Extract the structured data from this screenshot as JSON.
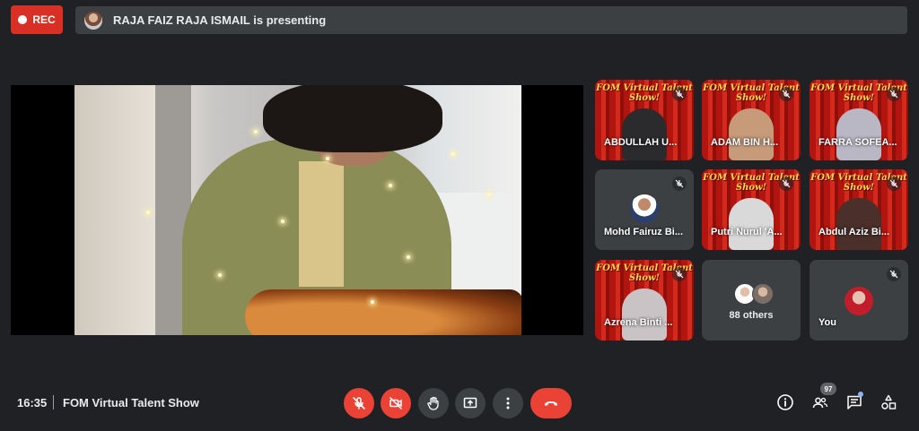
{
  "top_bar": {
    "record_label": "REC",
    "presenting_text": "RAJA FAIZ RAJA ISMAIL is presenting"
  },
  "banner_text": "FOM Virtual Talent Show!",
  "participants": [
    {
      "name": "ABDULLAH U...",
      "style": "red"
    },
    {
      "name": "ADAM BIN H...",
      "style": "red"
    },
    {
      "name": "FARRA SOFEA...",
      "style": "red"
    },
    {
      "name": "Mohd Fairuz Bi...",
      "style": "avatar"
    },
    {
      "name": "Putri Nurul 'A...",
      "style": "red"
    },
    {
      "name": "Abdul Aziz Bi...",
      "style": "red"
    },
    {
      "name": "Azrena Binti ...",
      "style": "red"
    }
  ],
  "others": {
    "label": "88 others"
  },
  "self": {
    "label": "You"
  },
  "bottom_bar": {
    "time": "16:35",
    "meeting_title": "FOM Virtual Talent Show",
    "people_count": "97"
  },
  "colors": {
    "background": "#202124",
    "tile": "#3c4043",
    "danger": "#ea4335",
    "banner": "#ffd84a"
  },
  "icons": {
    "mic": "mic-off-icon",
    "camera": "camera-off-icon",
    "hand": "raise-hand-icon",
    "present": "present-screen-icon",
    "more": "more-options-icon",
    "end": "end-call-icon",
    "info": "info-icon",
    "people": "people-icon",
    "chat": "chat-icon",
    "activities": "activities-icon"
  }
}
